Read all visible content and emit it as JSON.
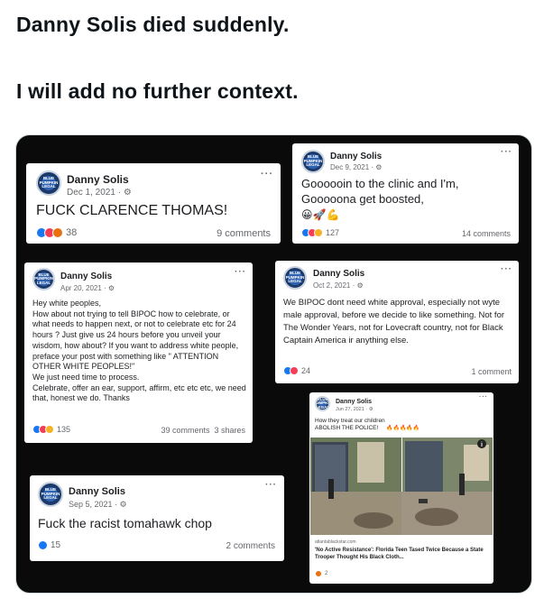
{
  "tweet": {
    "line1": "Danny Solis died suddenly.",
    "line2": "I will add no further context."
  },
  "posts": [
    {
      "name": "Danny Solis",
      "date": "Dec 1, 2021 · ⚙",
      "text": "FUCK CLARENCE THOMAS!",
      "reactions": "38",
      "comments": "9 comments",
      "reaction_icons": [
        "like",
        "love",
        "angry"
      ]
    },
    {
      "name": "Danny Solis",
      "date": "Dec 9, 2021 · ⚙",
      "text": "Goooooin to the clinic and I'm, Gooooona get boosted,",
      "emoji_line": "😀🚀💪",
      "reactions": "127",
      "comments": "14 comments",
      "reaction_icons": [
        "like",
        "love",
        "care"
      ]
    },
    {
      "name": "Danny Solis",
      "date": "Apr 20, 2021 · ⚙",
      "text": "Hey white peoples,\nHow about not trying to tell BIPOC how to celebrate, or what needs to happen next, or not to celebrate etc for 24 hours ? Just give us 24 hours before you unveil your wisdom, how about? If you want to address white people, preface your post with something like \" ATTENTION OTHER WHITE PEOPLES!\"\nWe just need time to process.\nCelebrate, offer an ear, support, affirm, etc etc etc, we need that, honest we do. Thanks",
      "reactions": "135",
      "comments": "39 comments  3 shares",
      "reaction_icons": [
        "like",
        "love",
        "care"
      ]
    },
    {
      "name": "Danny Solis",
      "date": "Oct 2, 2021 · ⚙",
      "text": "We BIPOC dont need white approval, especially not wyte male approval, before we decide to like something. Not for The Wonder Years, not for Lovecraft country, not for Black Captain America ir anything else.",
      "reactions": "24",
      "comments": "1 comment",
      "reaction_icons": [
        "like",
        "love"
      ]
    },
    {
      "name": "Danny Solis",
      "date": "Jun 27, 2021 · ⚙",
      "text": "How they treat our children\nABOLISH THE POLICE!",
      "fire": "🔥🔥🔥🔥🔥",
      "link_domain": "atlantablackstar.com",
      "link_title": "'No Active Resistance': Florida Teen Tased Twice Because a State Trooper Thought His Black Cloth...",
      "reactions": "2",
      "reaction_icons": [
        "angry"
      ]
    },
    {
      "name": "Danny Solis",
      "date": "Sep 5, 2021 · ⚙",
      "text": "Fuck the racist tomahawk chop",
      "reactions": "15",
      "comments": "2 comments",
      "reaction_icons": [
        "like"
      ]
    }
  ],
  "more_label": "···",
  "avatar_text": "BLUE PUMPKIN LEGAL"
}
